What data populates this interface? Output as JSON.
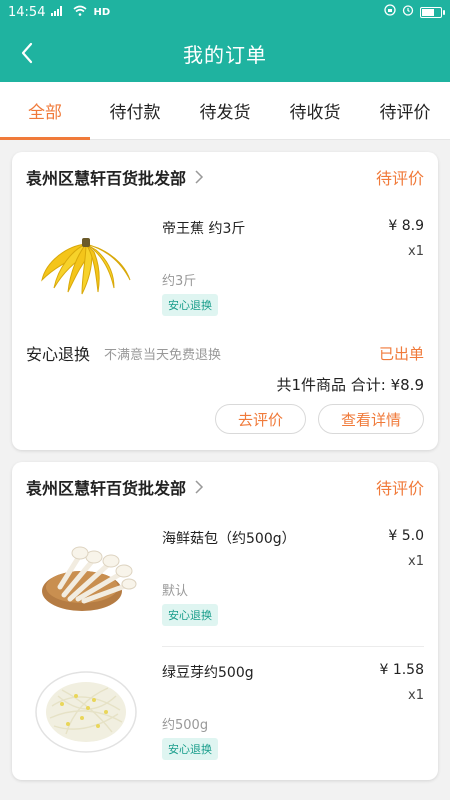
{
  "statusbar": {
    "time": "14:54",
    "signal": "4G",
    "network": "HD"
  },
  "navbar": {
    "title": "我的订单"
  },
  "tabs": [
    {
      "label": "全部",
      "active": true
    },
    {
      "label": "待付款"
    },
    {
      "label": "待发货"
    },
    {
      "label": "待收货"
    },
    {
      "label": "待评价"
    }
  ],
  "orders": [
    {
      "shop": "袁州区慧轩百货批发部",
      "status": "待评价",
      "items": [
        {
          "name": "帝王蕉 约3斤",
          "price": "¥ 8.9",
          "qty": "x1",
          "spec": "约3斤",
          "tag": "安心退换",
          "image": "banana"
        }
      ],
      "assure_title": "安心退换",
      "assure_sub": "不满意当天免费退换",
      "delivery_state": "已出单",
      "total": "共1件商品 合计: ¥8.9",
      "btn_review": "去评价",
      "btn_detail": "查看详情"
    },
    {
      "shop": "袁州区慧轩百货批发部",
      "status": "待评价",
      "items": [
        {
          "name": "海鲜菇包（约500g）",
          "price": "¥ 5.0",
          "qty": "x1",
          "spec": "默认",
          "tag": "安心退换",
          "image": "mushroom"
        },
        {
          "name": "绿豆芽约500g",
          "price": "¥ 1.58",
          "qty": "x1",
          "spec": "约500g",
          "tag": "安心退换",
          "image": "sprouts"
        }
      ]
    }
  ],
  "colors": {
    "brand": "#1fb3a0",
    "accent": "#f07a3a"
  }
}
